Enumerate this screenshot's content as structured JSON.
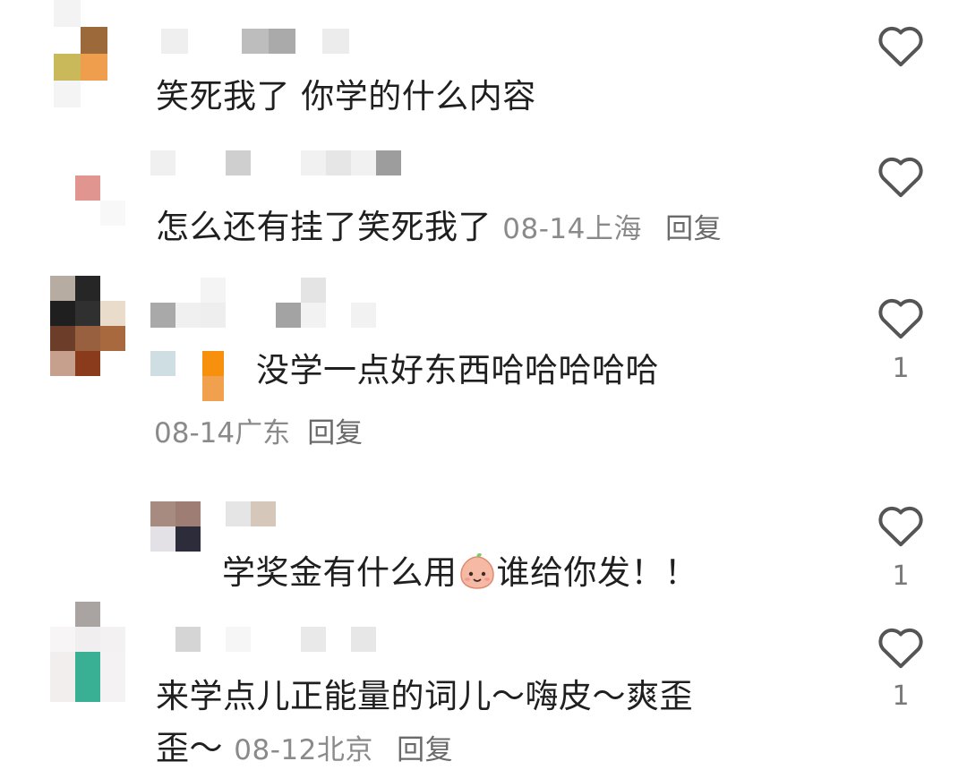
{
  "comments": [
    {
      "text": "笑死我了 你学的什么内容",
      "date": "",
      "location": "",
      "reply_label": "",
      "likes": ""
    },
    {
      "text": "怎么还有挂了笑死我了",
      "date": "08-14",
      "location": "上海",
      "reply_label": "回复",
      "likes": ""
    },
    {
      "text": "没学一点好东西哈哈哈哈哈",
      "date": "08-14",
      "location": "广东",
      "reply_label": "回复",
      "likes": "1"
    },
    {
      "text_before": "学奖金有什么用",
      "emoji": "peach-face-emoji",
      "text_after": "谁给你发！！",
      "likes": "1"
    },
    {
      "text_line1": "来学点儿正能量的词儿～嗨皮～爽歪",
      "text_line2": "歪～",
      "date": "08-12",
      "location": "北京",
      "reply_label": "回复",
      "likes": "1"
    }
  ],
  "colors": {
    "text": "#1f1f1f",
    "meta": "#8a8a8a",
    "heart_stroke": "#555555"
  },
  "icons": [
    "heart-outline-icon",
    "peach-face-emoji"
  ]
}
